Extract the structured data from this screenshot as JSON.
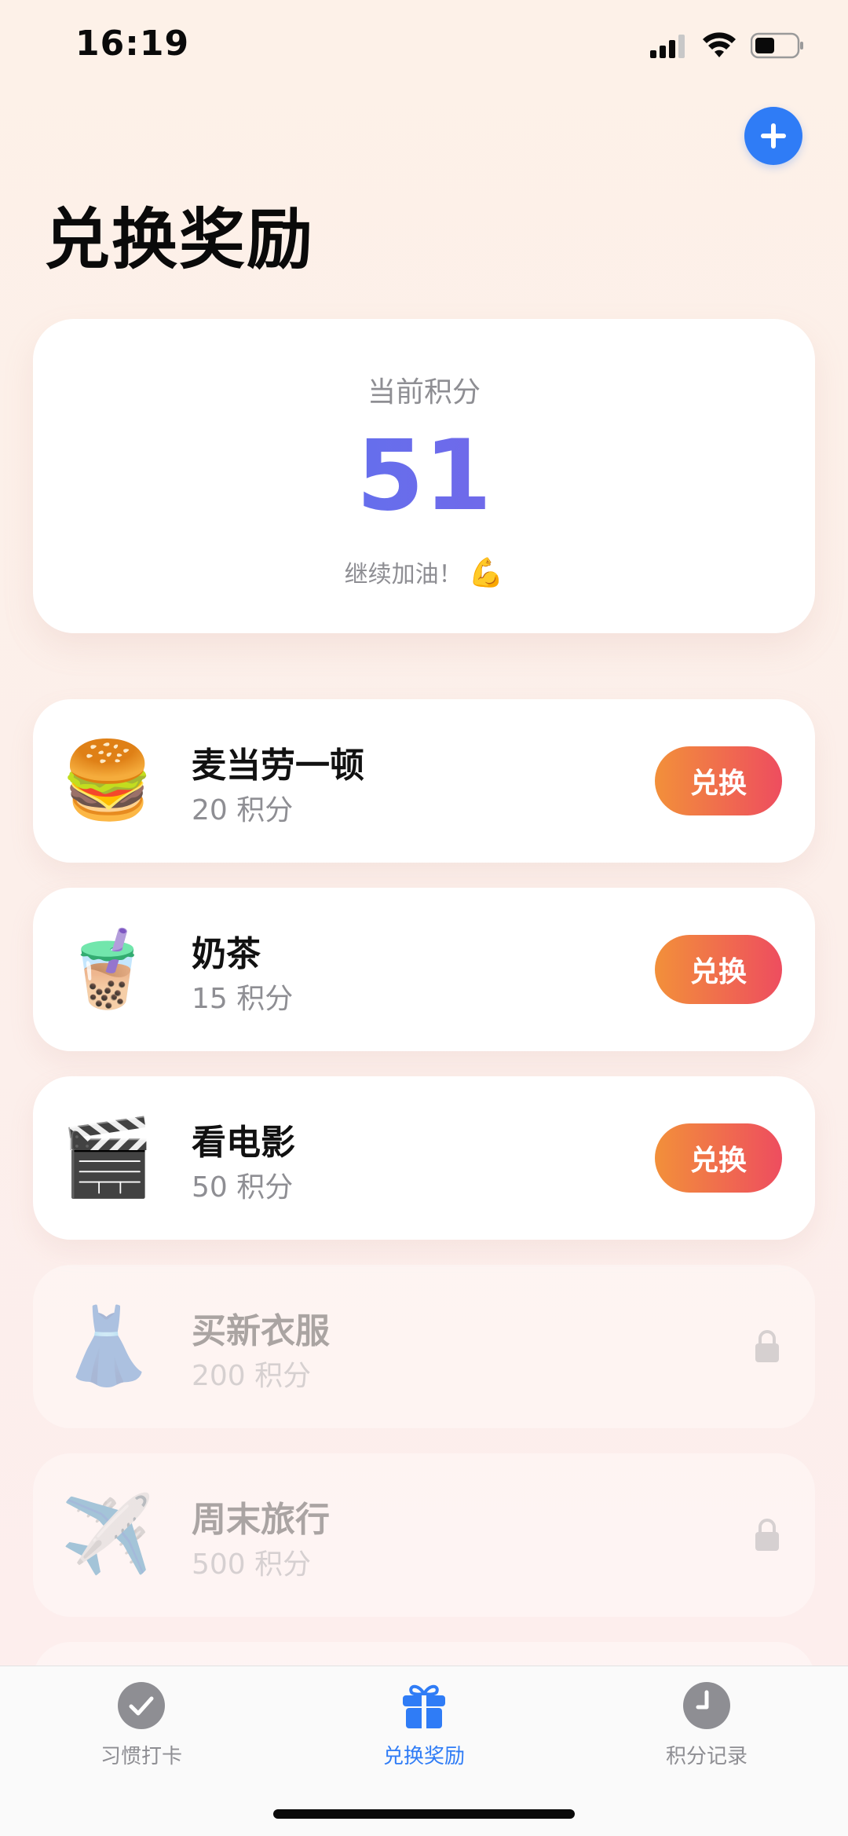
{
  "status": {
    "time": "16:19"
  },
  "header": {
    "title": "兑换奖励"
  },
  "points": {
    "label": "当前积分",
    "value": "51",
    "cheer": "继续加油！",
    "cheer_emoji": "💪"
  },
  "rewards": [
    {
      "name": "麦当劳一顿",
      "cost": "20 积分",
      "emoji": "🍔",
      "action": "兑换",
      "locked": false
    },
    {
      "name": "奶茶",
      "cost": "15 积分",
      "emoji": "🧋",
      "action": "兑换",
      "locked": false
    },
    {
      "name": "看电影",
      "cost": "50 积分",
      "emoji": "🎬",
      "action": "兑换",
      "locked": false
    },
    {
      "name": "买新衣服",
      "cost": "200 积分",
      "emoji": "👗",
      "locked": true
    },
    {
      "name": "周末旅行",
      "cost": "500 积分",
      "emoji": "✈️",
      "locked": true
    }
  ],
  "tabs": [
    {
      "label": "习惯打卡",
      "icon": "checkmark-icon",
      "active": false
    },
    {
      "label": "兑换奖励",
      "icon": "gift-icon",
      "active": true
    },
    {
      "label": "积分记录",
      "icon": "clock-icon",
      "active": false
    }
  ],
  "colors": {
    "accent": "#2f7cf6",
    "redeem_start": "#f2903a",
    "redeem_end": "#ee4d5f"
  }
}
